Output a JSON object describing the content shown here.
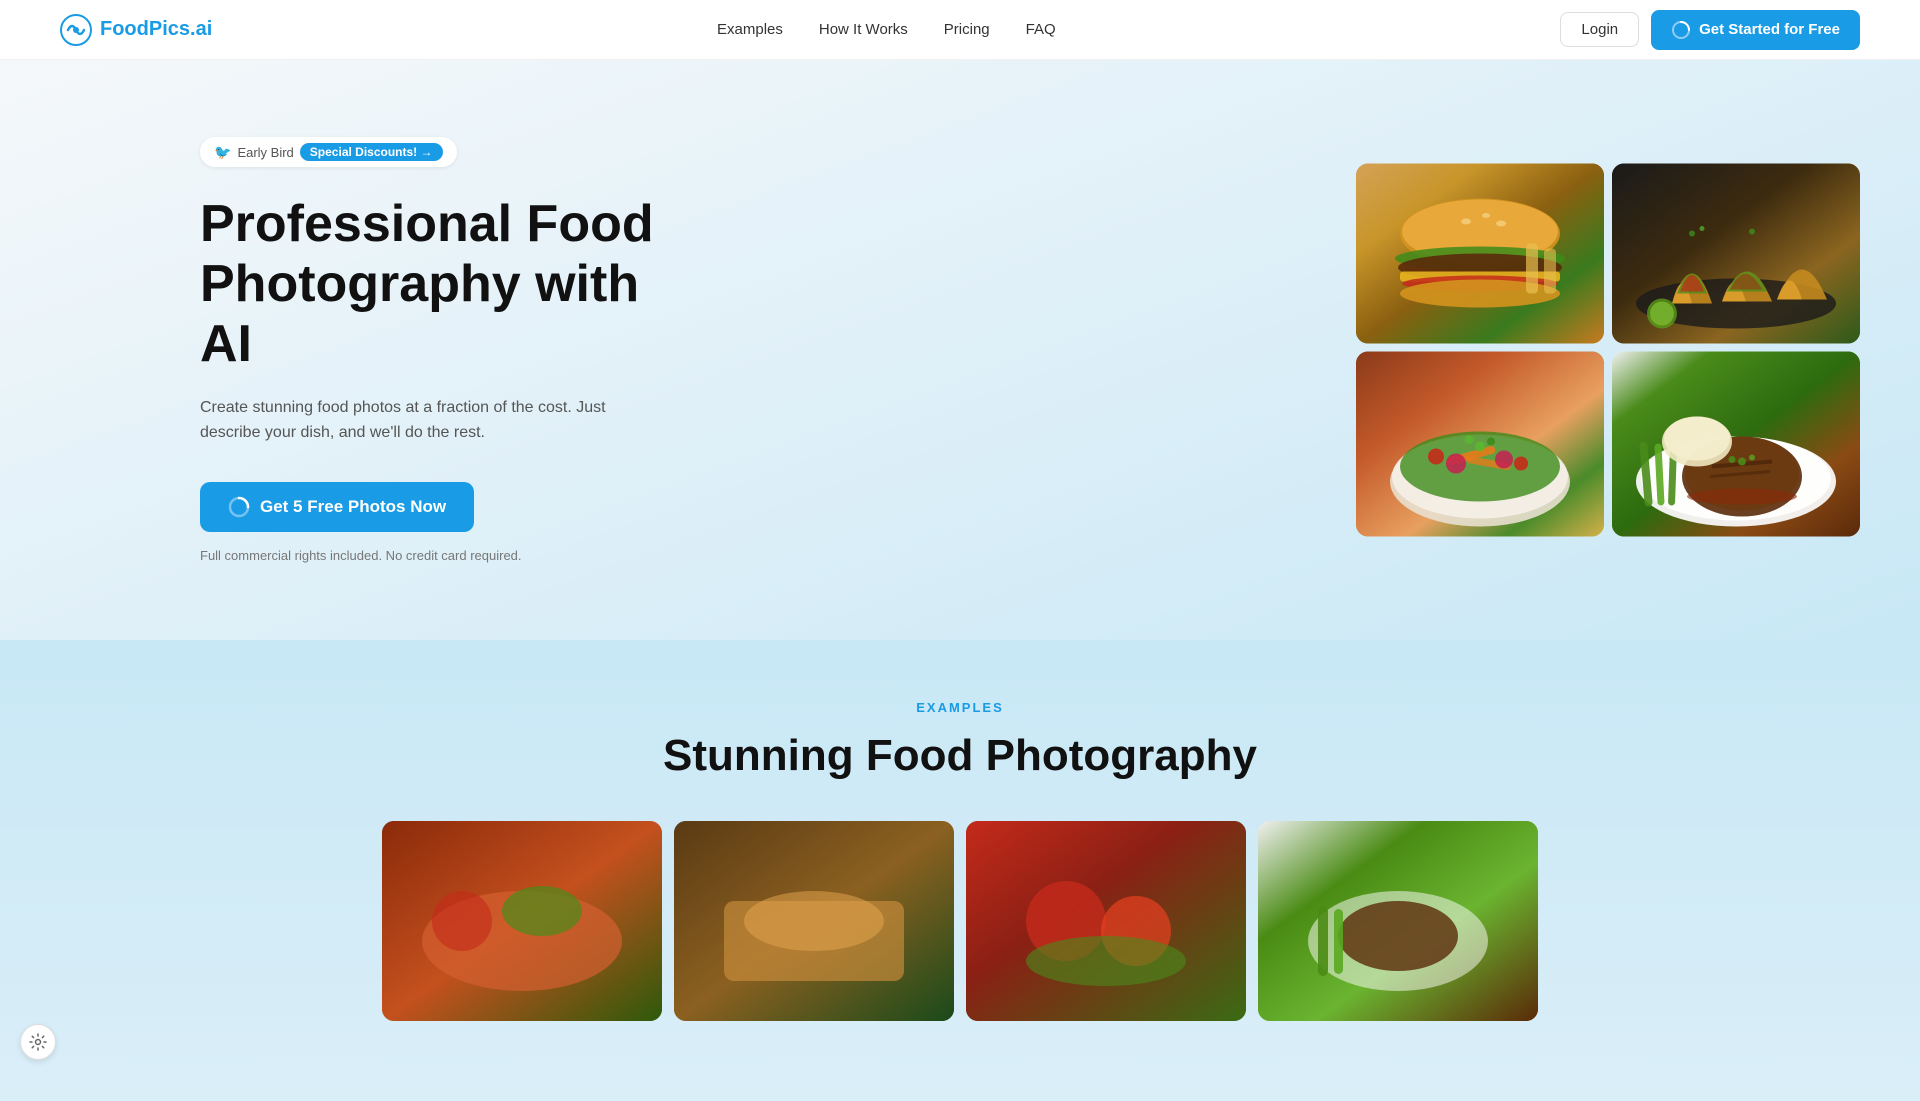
{
  "brand": {
    "name": "FoodPics.ai"
  },
  "navbar": {
    "links": [
      {
        "id": "examples",
        "label": "Examples"
      },
      {
        "id": "how-it-works",
        "label": "How It Works"
      },
      {
        "id": "pricing",
        "label": "Pricing"
      },
      {
        "id": "faq",
        "label": "FAQ"
      }
    ],
    "login_label": "Login",
    "cta_label": "Get Started for Free"
  },
  "hero": {
    "badge_bird": "🐦",
    "badge_early": "Early Bird",
    "badge_discount": "Special Discounts! →",
    "title_line1": "Professional Food",
    "title_line2": "Photography with AI",
    "subtitle": "Create stunning food photos at a fraction of the cost. Just describe your dish, and we'll do the rest.",
    "cta_label": "Get 5 Free Photos Now",
    "note": "Full commercial rights included. No credit card required."
  },
  "examples_section": {
    "label": "EXAMPLES",
    "title": "Stunning Food Photography"
  },
  "food_images": [
    {
      "id": "burger",
      "alt": "Burger with fries"
    },
    {
      "id": "tacos",
      "alt": "Tacos on dark plate"
    },
    {
      "id": "salad",
      "alt": "Fresh colorful salad"
    },
    {
      "id": "steak",
      "alt": "Steak with asparagus"
    }
  ],
  "example_photos": [
    {
      "id": "ep1",
      "alt": "Food example 1"
    },
    {
      "id": "ep2",
      "alt": "Food example 2"
    },
    {
      "id": "ep3",
      "alt": "Food example 3"
    },
    {
      "id": "ep4",
      "alt": "Food example 4"
    }
  ]
}
